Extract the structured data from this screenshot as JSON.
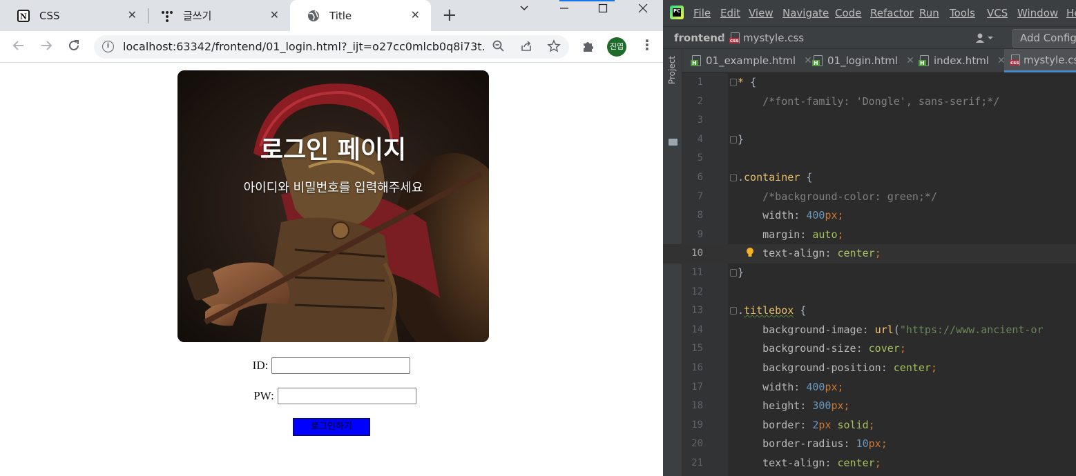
{
  "browser": {
    "tabs": [
      {
        "label": "CSS",
        "icon": "notion-icon",
        "active": false
      },
      {
        "label": "글쓰기",
        "icon": "tistory-icon",
        "active": false
      },
      {
        "label": "Title",
        "icon": "globe-icon",
        "active": true
      }
    ],
    "url": "localhost:63342/frontend/01_login.html?_ijt=o27cc0mlcb0q8i73t...",
    "profile_label": "진엽"
  },
  "page": {
    "title": "로그인 페이지",
    "subtitle": "아이디와 비밀번호를 입력해주세요",
    "id_label": "ID:",
    "pw_label": "PW:",
    "id_value": "",
    "pw_value": "",
    "login_button": "로그인하기",
    "colors": {
      "button_bg": "#0000ff"
    }
  },
  "ide": {
    "menu": [
      "File",
      "Edit",
      "View",
      "Navigate",
      "Code",
      "Refactor",
      "Run",
      "Tools",
      "VCS",
      "Window",
      "He"
    ],
    "breadcrumb": {
      "project": "frontend",
      "file": "mystyle.css"
    },
    "add_config": "Add Configu",
    "side_label": "Project",
    "tabs": [
      {
        "label": "01_example.html",
        "type": "html"
      },
      {
        "label": "01_login.html",
        "type": "html"
      },
      {
        "label": "index.html",
        "type": "html"
      },
      {
        "label": "mystyle.css",
        "type": "css",
        "active": true
      }
    ],
    "current_line": 10,
    "code_lines": [
      "* {",
      "    /*font-family: 'Dongle', sans-serif;*/",
      "",
      "}",
      "",
      ".container {",
      "    /*background-color: green;*/",
      "    width: 400px;",
      "    margin: auto;",
      "    text-align: center;",
      "}",
      "",
      ".titlebox {",
      "    background-image: url(\"https://www.ancient-or",
      "    background-size: cover;",
      "    background-position: center;",
      "    width: 400px;",
      "    height: 300px;",
      "    border: 2px solid;",
      "    border-radius: 10px;",
      "    text-align: center;"
    ]
  }
}
